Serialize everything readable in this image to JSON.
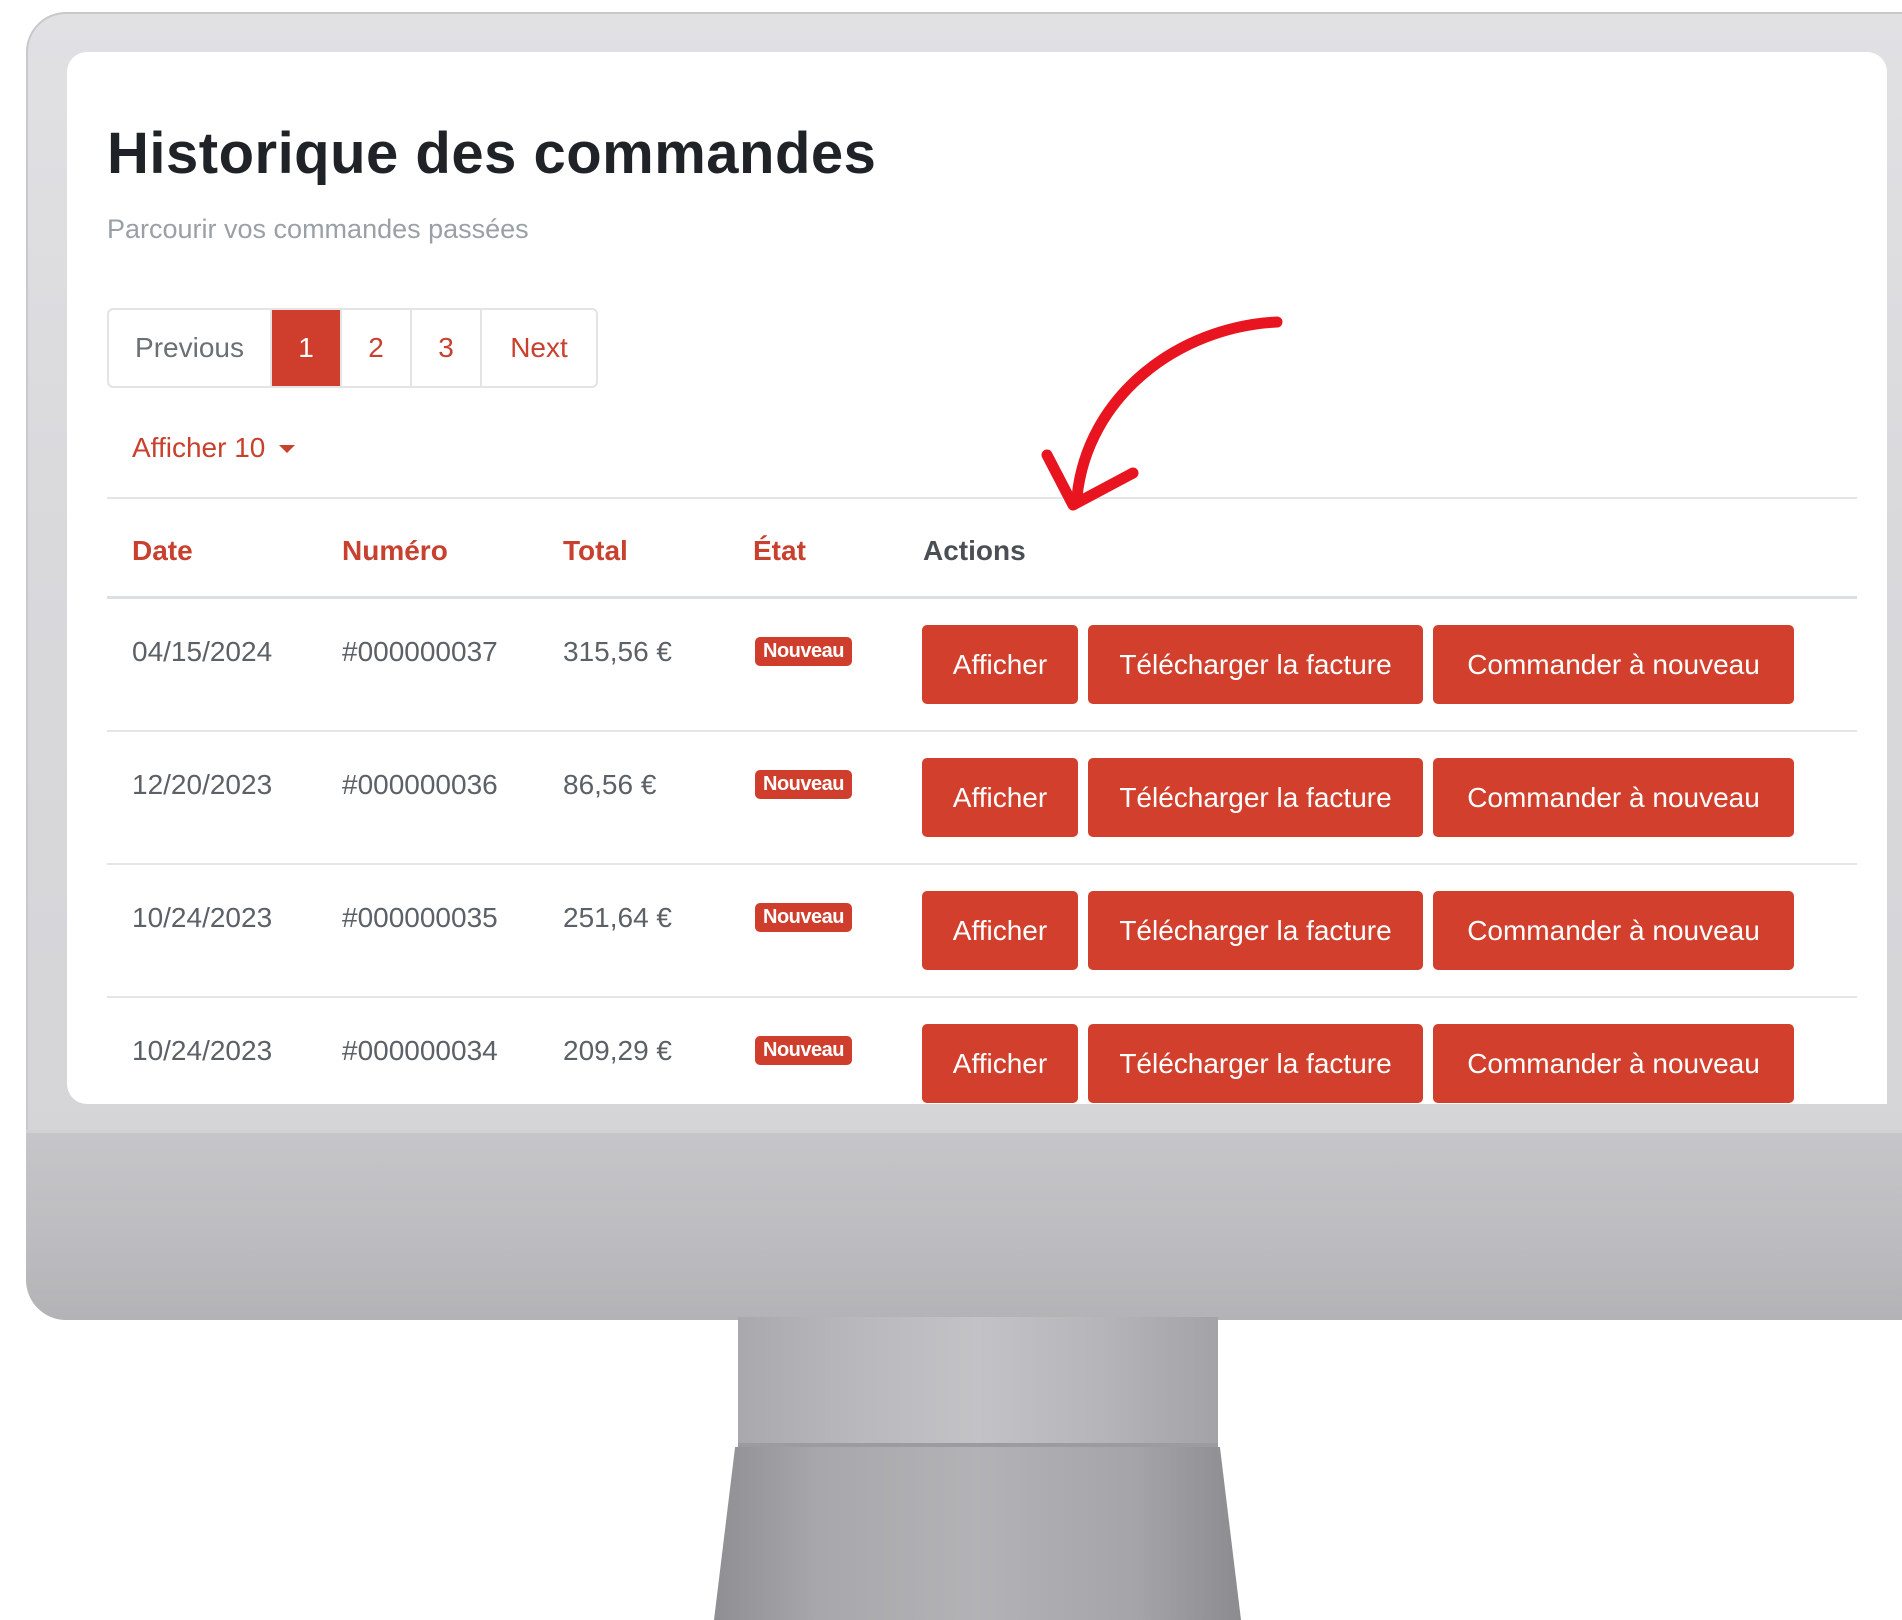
{
  "page": {
    "title": "Historique des commandes",
    "subtitle": "Parcourir vos commandes passées"
  },
  "pagination": {
    "previous": "Previous",
    "pages": [
      "1",
      "2",
      "3"
    ],
    "active_page": "1",
    "next": "Next"
  },
  "page_size": {
    "label": "Afficher 10"
  },
  "table": {
    "headers": {
      "date": "Date",
      "number": "Numéro",
      "total": "Total",
      "status": "État",
      "actions": "Actions"
    },
    "rows": [
      {
        "date": "04/15/2024",
        "number": "#000000037",
        "total": "315,56 €",
        "status": "Nouveau"
      },
      {
        "date": "12/20/2023",
        "number": "#000000036",
        "total": "86,56 €",
        "status": "Nouveau"
      },
      {
        "date": "10/24/2023",
        "number": "#000000035",
        "total": "251,64 €",
        "status": "Nouveau"
      },
      {
        "date": "10/24/2023",
        "number": "#000000034",
        "total": "209,29 €",
        "status": "Nouveau"
      }
    ],
    "actions": {
      "view": "Afficher",
      "invoice": "Télécharger la facture",
      "reorder": "Commander à nouveau"
    }
  },
  "colors": {
    "accent": "#cf3e2d",
    "annotation_arrow": "#e8141f"
  },
  "annotation": {
    "icon": "curved-arrow-icon"
  }
}
